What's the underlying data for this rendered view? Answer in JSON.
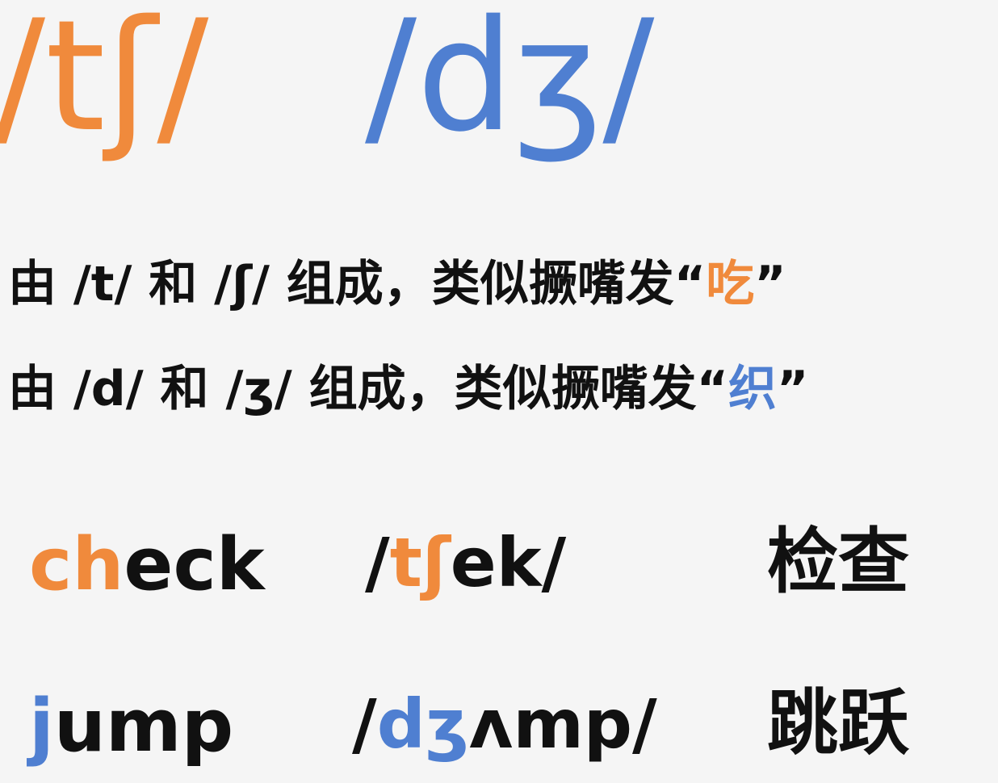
{
  "colors": {
    "orange": "#f08a3c",
    "blue": "#4f7fd1",
    "text": "#111111",
    "background": "#f5f5f5"
  },
  "symbols": {
    "ts": "/tʃ/",
    "dz": "/dʒ/"
  },
  "descriptions": [
    {
      "prefix": "由 /t/ 和 /ʃ/ 组成，类似撅嘴发",
      "open_quote": "“",
      "highlight": "吃",
      "close_quote": "”"
    },
    {
      "prefix": "由 /d/ 和 /ʒ/ 组成，类似撅嘴发",
      "open_quote": "“",
      "highlight": "织",
      "close_quote": "”"
    }
  ],
  "examples": [
    {
      "word_highlight": "ch",
      "word_rest": "eck",
      "ipa_open": "/",
      "ipa_highlight": "tʃ",
      "ipa_rest": "ek/",
      "meaning": "检查"
    },
    {
      "word_highlight": "j",
      "word_rest": "ump",
      "ipa_open": "/",
      "ipa_highlight": "dʒ",
      "ipa_rest": "ʌmp/",
      "meaning": "跳跃"
    }
  ]
}
